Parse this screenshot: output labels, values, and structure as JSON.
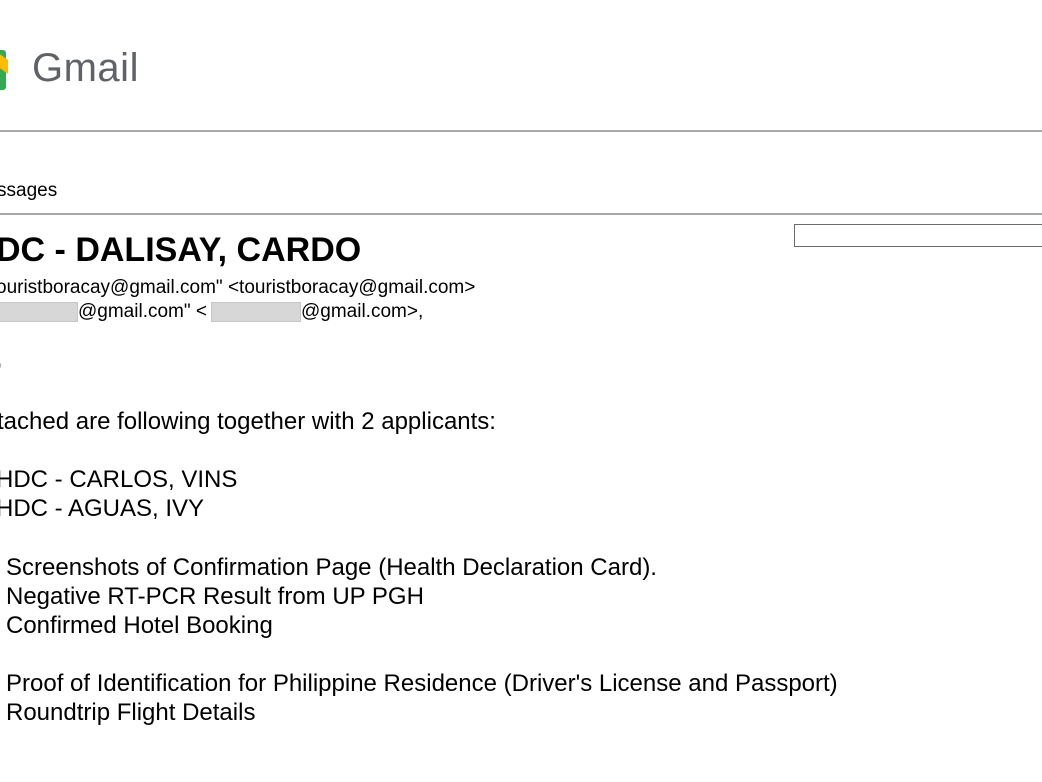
{
  "header": {
    "logo_text": "Gmail",
    "logo_icon": "gmail-logo-icon",
    "logo_colors": [
      "#fbbc04",
      "#34a853"
    ]
  },
  "nav": {
    "messages_label": "ssages"
  },
  "email": {
    "subject": "DC - DALISAY, CARDO",
    "from": "ouristboracay@gmail.com\" <touristboracay@gmail.com>",
    "to_part_1": "@gmail.com\" <",
    "to_part_2": "@gmail.com>,",
    "stray_mark": "'",
    "intro": "tached are following together with 2 applicants:",
    "applicants": [
      "HDC - CARLOS, VINS",
      "HDC - AGUAS, IVY"
    ],
    "documents_group_1": [
      "Screenshots of Confirmation Page (Health Declaration Card).",
      "Negative RT-PCR Result from UP PGH",
      "Confirmed Hotel Booking"
    ],
    "documents_group_2": [
      "Proof of Identification for Philippine Residence (Driver's License and Passport)",
      "Roundtrip Flight Details"
    ]
  },
  "colors": {
    "logo_text": "#5f6368",
    "rule": "#a9a9a9",
    "redaction": "#d7d7d7"
  }
}
